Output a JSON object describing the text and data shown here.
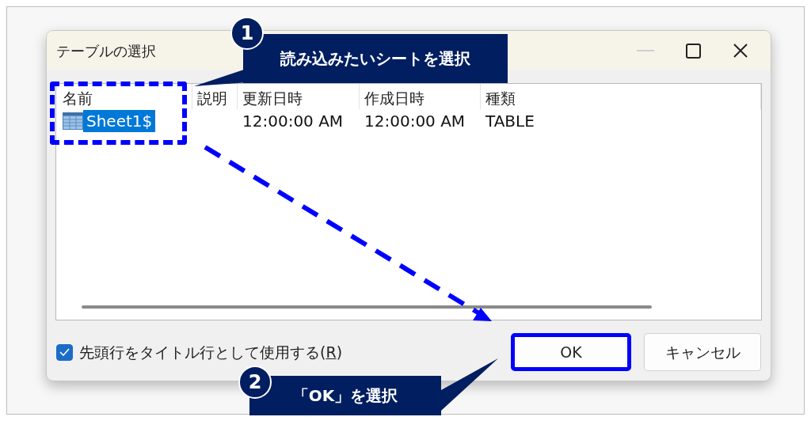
{
  "dialog": {
    "title": "テーブルの選択",
    "columns": [
      "名前",
      "説明",
      "更新日時",
      "作成日時",
      "種類"
    ],
    "rows": [
      {
        "name": "Sheet1$",
        "updated": "12:00:00 AM",
        "created": "12:00:00 AM",
        "type": "TABLE",
        "selected": true
      }
    ],
    "checkbox": {
      "label": "先頭行をタイトル行として使用する(",
      "access_key": "R",
      "label_end": ")",
      "checked": true
    },
    "buttons": [
      {
        "label": "OK",
        "highlighted": true
      },
      {
        "label": "キャンセル",
        "highlighted": false
      }
    ]
  },
  "callouts": [
    {
      "number": "1",
      "text": "読み込みたいシートを選択"
    },
    {
      "number": "2",
      "text": "「OK」を選択"
    }
  ]
}
